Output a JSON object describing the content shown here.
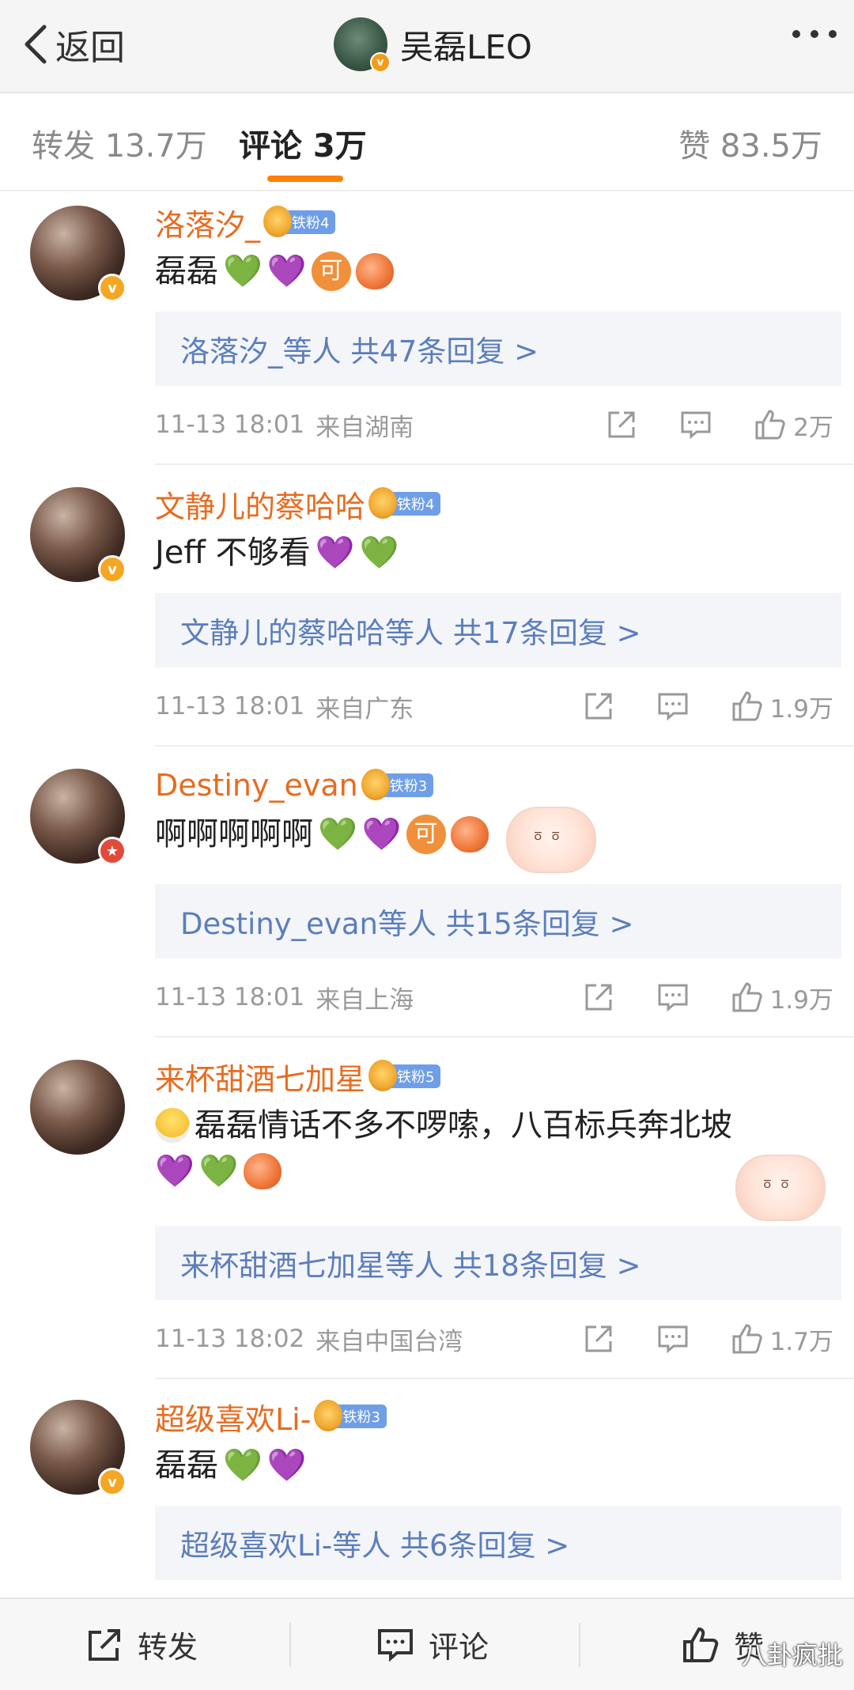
{
  "header": {
    "back_label": "返回",
    "title": "吴磊LEO"
  },
  "tabs": {
    "repost": "转发 13.7万",
    "comments": "评论 3万",
    "likes": "赞 83.5万"
  },
  "comments": [
    {
      "user": "洛落汐_",
      "fan_badge": "铁粉4",
      "text": "磊磊",
      "emojis": [
        "green-heart",
        "purple-heart",
        "ke",
        "peach"
      ],
      "reply_summary": "洛落汐_等人 共47条回复 >",
      "time": "11-13 18:01",
      "source": "来自湖南",
      "likes": "2万"
    },
    {
      "user": "文静儿的蔡哈哈",
      "fan_badge": "铁粉4",
      "text": "Jeff 不够看",
      "emojis": [
        "purple-heart",
        "green-heart"
      ],
      "reply_summary": "文静儿的蔡哈哈等人 共17条回复 >",
      "time": "11-13 18:01",
      "source": "来自广东",
      "likes": "1.9万"
    },
    {
      "user": "Destiny_evan",
      "fan_badge": "铁粉3",
      "text": "啊啊啊啊啊",
      "emojis": [
        "green-heart",
        "purple-heart",
        "ke",
        "peach"
      ],
      "reply_summary": "Destiny_evan等人 共15条回复 >",
      "time": "11-13 18:01",
      "source": "来自上海",
      "likes": "1.9万"
    },
    {
      "user": "来杯甜酒七加星",
      "fan_badge": "铁粉5",
      "text": "磊磊情话不多不啰嗦，八百标兵奔北坡",
      "emojis": [
        "purple-heart",
        "green-heart",
        "peach"
      ],
      "reply_summary": "来杯甜酒七加星等人 共18条回复 >",
      "time": "11-13 18:02",
      "source": "来自中国台湾",
      "likes": "1.7万"
    },
    {
      "user": "超级喜欢Li-",
      "fan_badge": "铁粉3",
      "text": "磊磊",
      "emojis": [
        "green-heart",
        "purple-heart"
      ],
      "reply_summary": "超级喜欢Li-等人 共6条回复 >",
      "time": "",
      "source": "",
      "likes": ""
    }
  ],
  "emoji_glyphs": {
    "green-heart": "💚",
    "purple-heart": "💜",
    "ke": "可"
  },
  "bottom_bar": {
    "repost": "转发",
    "comment": "评论",
    "like": "赞"
  },
  "watermark": "八卦疯批",
  "colors": {
    "username": "#e86b1f",
    "reply_link": "#5b7ebd",
    "tab_accent": "#ff8200",
    "fan_badge": "#6f9ee8"
  }
}
